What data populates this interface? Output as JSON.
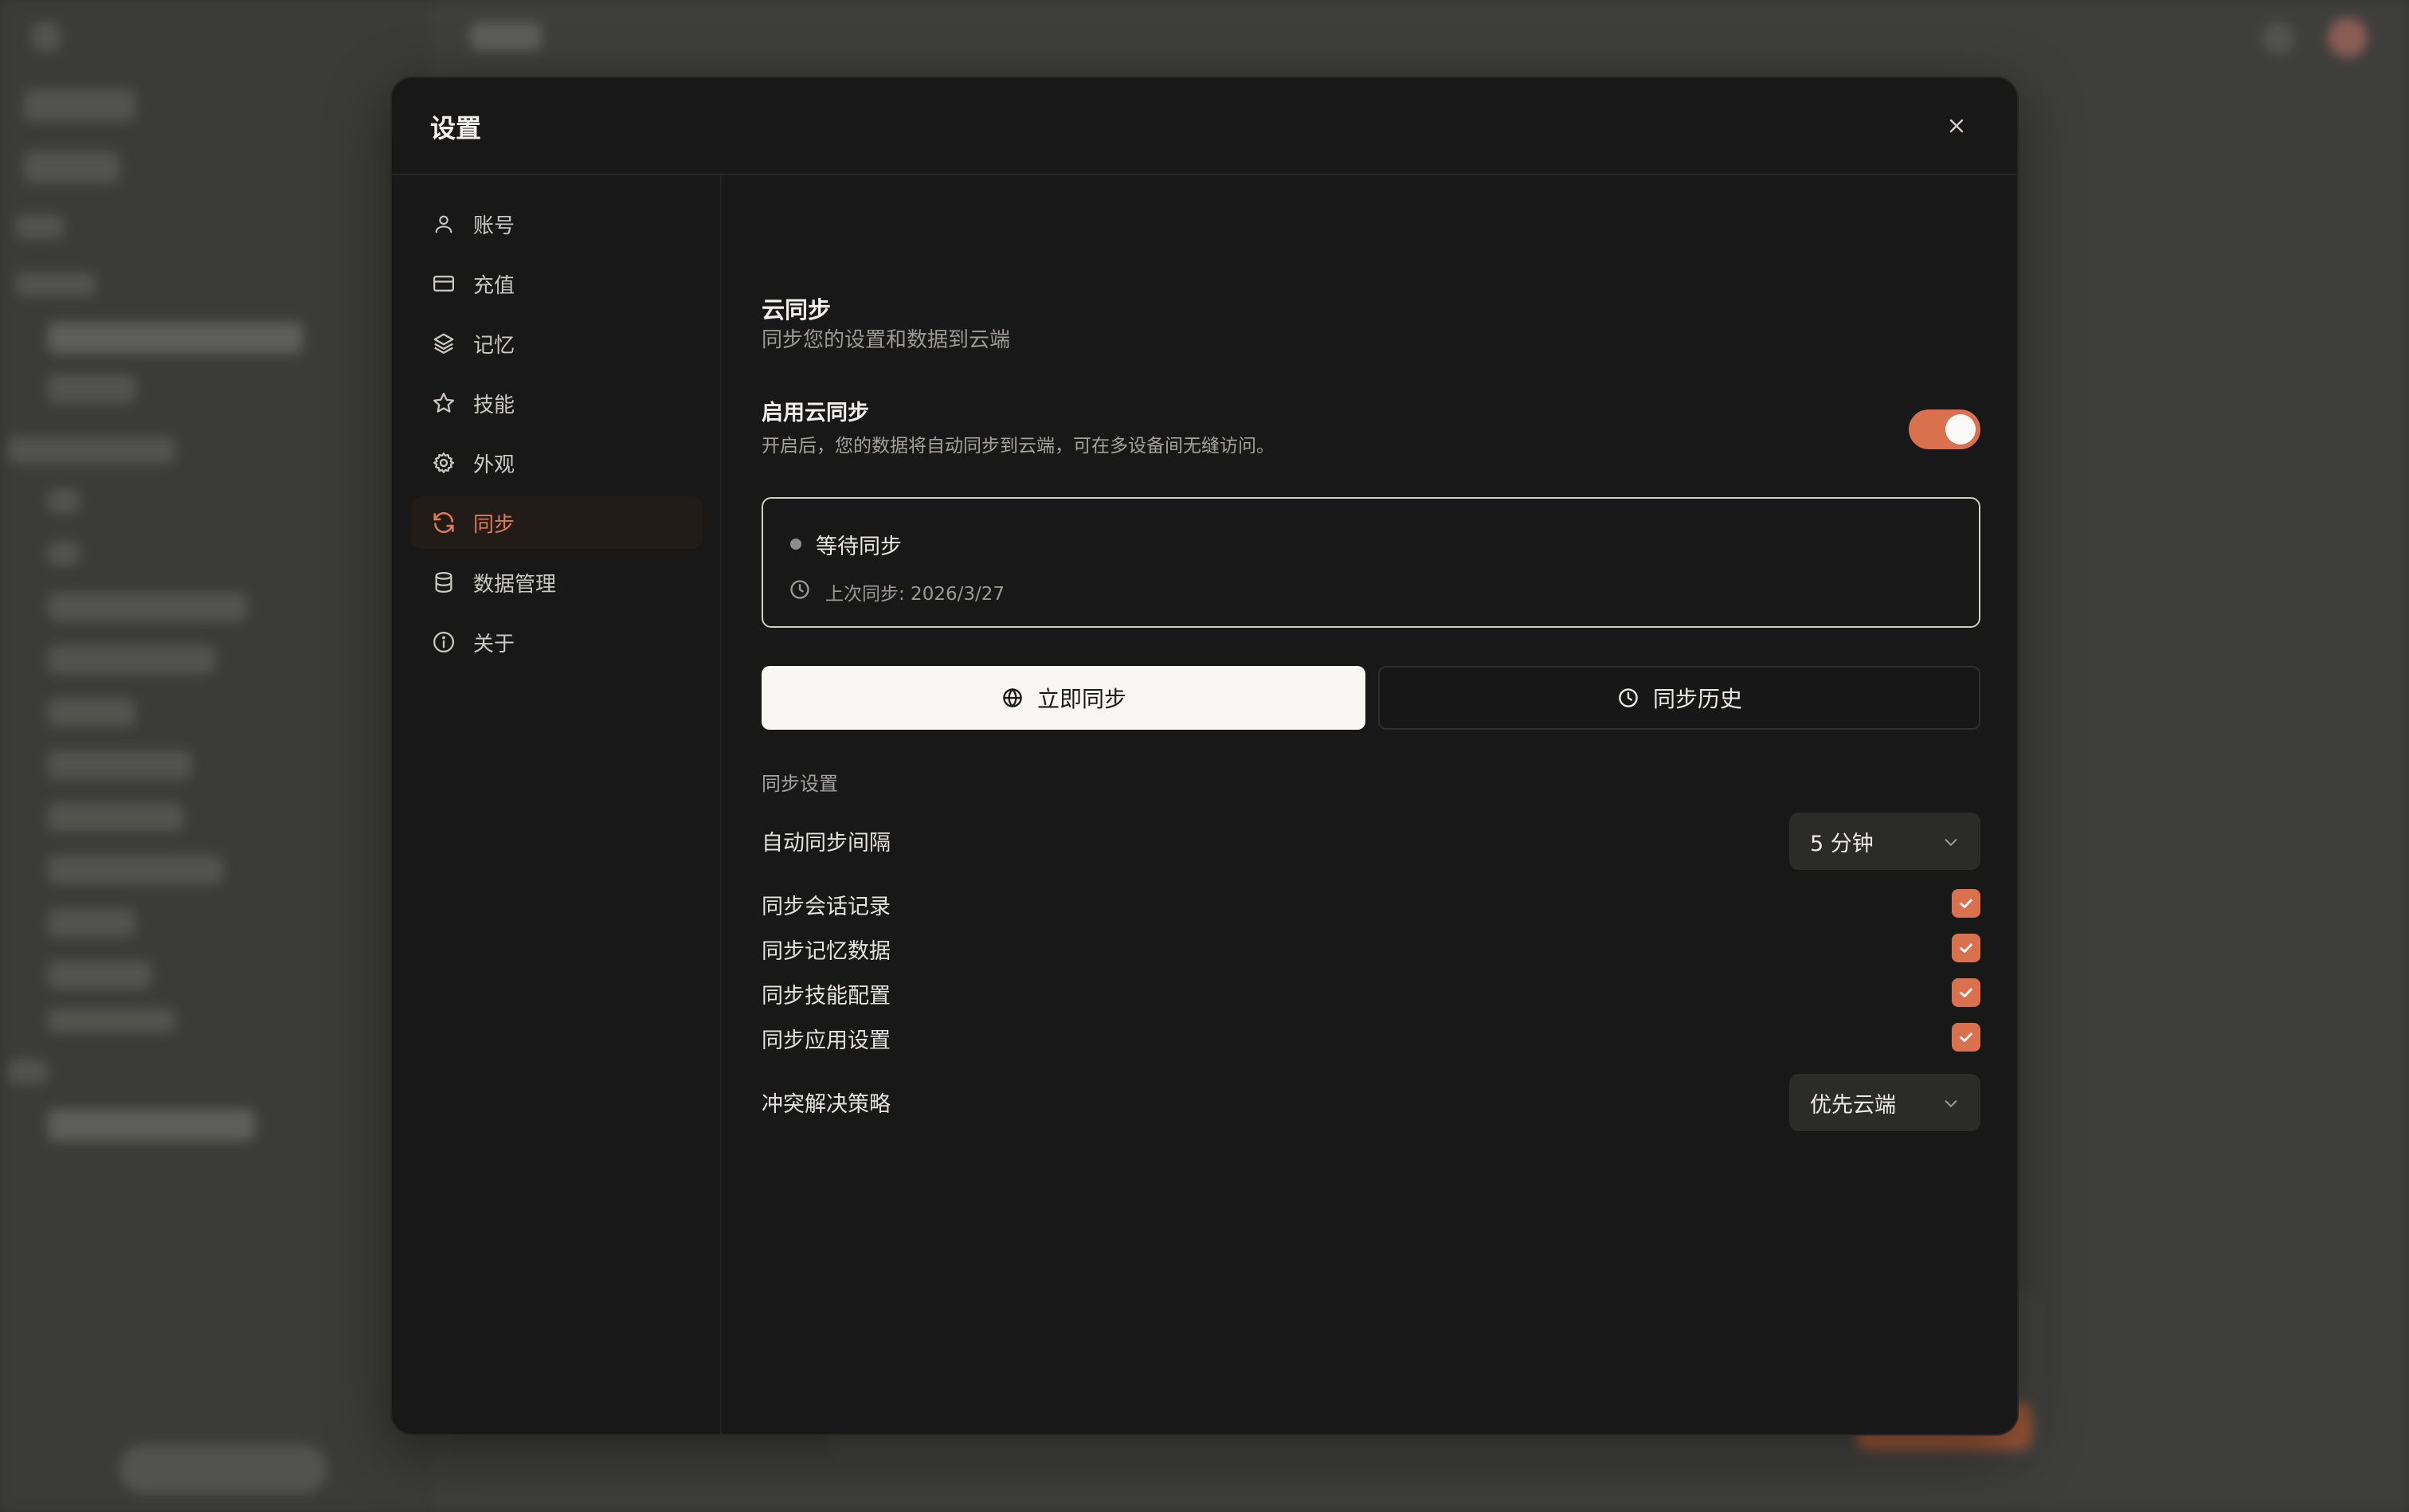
{
  "dialog": {
    "title": "设置",
    "close_icon": "close-icon"
  },
  "nav": {
    "items": [
      {
        "label": "账号",
        "icon": "user-icon",
        "active": false
      },
      {
        "label": "充值",
        "icon": "credit-card-icon",
        "active": false
      },
      {
        "label": "记忆",
        "icon": "layers-icon",
        "active": false
      },
      {
        "label": "技能",
        "icon": "star-icon",
        "active": false
      },
      {
        "label": "外观",
        "icon": "gear-icon",
        "active": false
      },
      {
        "label": "同步",
        "icon": "refresh-icon",
        "active": true
      },
      {
        "label": "数据管理",
        "icon": "database-icon",
        "active": false
      },
      {
        "label": "关于",
        "icon": "info-icon",
        "active": false
      }
    ]
  },
  "sync": {
    "title": "云同步",
    "subtitle": "同步您的设置和数据到云端",
    "enable": {
      "title": "启用云同步",
      "description": "开启后，您的数据将自动同步到云端，可在多设备间无缝访问。",
      "enabled": true
    },
    "status": {
      "text": "等待同步",
      "last_sync": "上次同步: 2026/3/27"
    },
    "buttons": {
      "sync_now": "立即同步",
      "history": "同步历史"
    },
    "settings_label": "同步设置",
    "interval": {
      "label": "自动同步间隔",
      "value": "5 分钟"
    },
    "options": [
      {
        "label": "同步会话记录",
        "checked": true
      },
      {
        "label": "同步记忆数据",
        "checked": true
      },
      {
        "label": "同步技能配置",
        "checked": true
      },
      {
        "label": "同步应用设置",
        "checked": true
      }
    ],
    "conflict": {
      "label": "冲突解决策略",
      "value": "优先云端"
    }
  },
  "colors": {
    "accent": "#d9714f",
    "dialog_bg": "#181818",
    "active_nav_text": "#e07a55"
  }
}
